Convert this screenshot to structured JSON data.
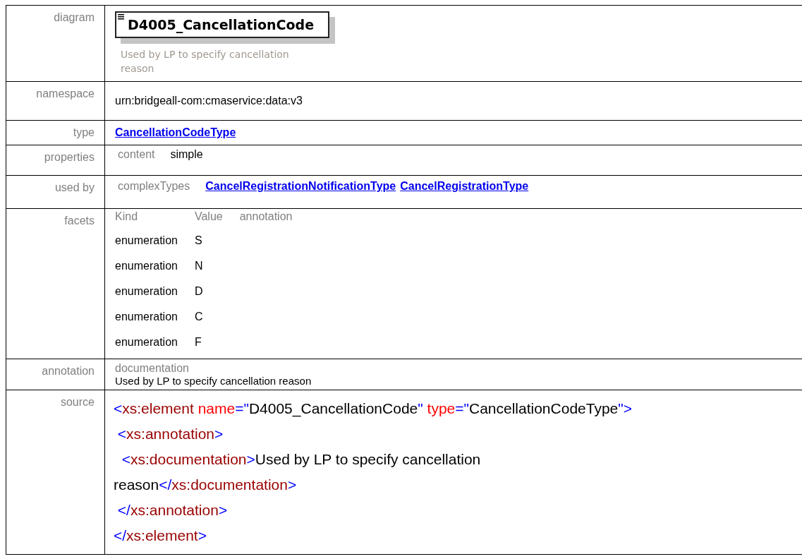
{
  "rows": [
    {
      "kind": "diagram",
      "label": "diagram",
      "element_name": "D4005_CancellationCode",
      "description": "Used by LP to specify cancellation reason"
    },
    {
      "kind": "text",
      "label": "namespace",
      "value": "urn:bridgeall-com:cmaservice:data:v3"
    },
    {
      "kind": "link",
      "label": "type",
      "value": "CancellationCodeType"
    },
    {
      "kind": "properties",
      "label": "properties",
      "key": "content",
      "value": "simple"
    },
    {
      "kind": "usedby",
      "label": "used by",
      "key": "complexTypes",
      "links": [
        "CancelRegistrationNotificationType",
        "CancelRegistrationType"
      ]
    },
    {
      "kind": "facets",
      "label": "facets",
      "columns": [
        "Kind",
        "Value",
        "annotation"
      ],
      "facets": [
        {
          "kind": "enumeration",
          "value": "S"
        },
        {
          "kind": "enumeration",
          "value": "N"
        },
        {
          "kind": "enumeration",
          "value": "D"
        },
        {
          "kind": "enumeration",
          "value": "C"
        },
        {
          "kind": "enumeration",
          "value": "F"
        }
      ]
    },
    {
      "kind": "annotation",
      "label": "annotation",
      "key": "documentation",
      "value": "Used by LP to specify cancellation reason"
    },
    {
      "kind": "source",
      "label": "source",
      "lines": [
        "<xs:element name=\"D4005_CancellationCode\" type=\"CancellationCodeType\">",
        " <xs:annotation>",
        "  <xs:documentation>Used by LP to specify cancellation",
        "reason</xs:documentation>",
        " </xs:annotation>",
        "</xs:element>"
      ]
    }
  ]
}
